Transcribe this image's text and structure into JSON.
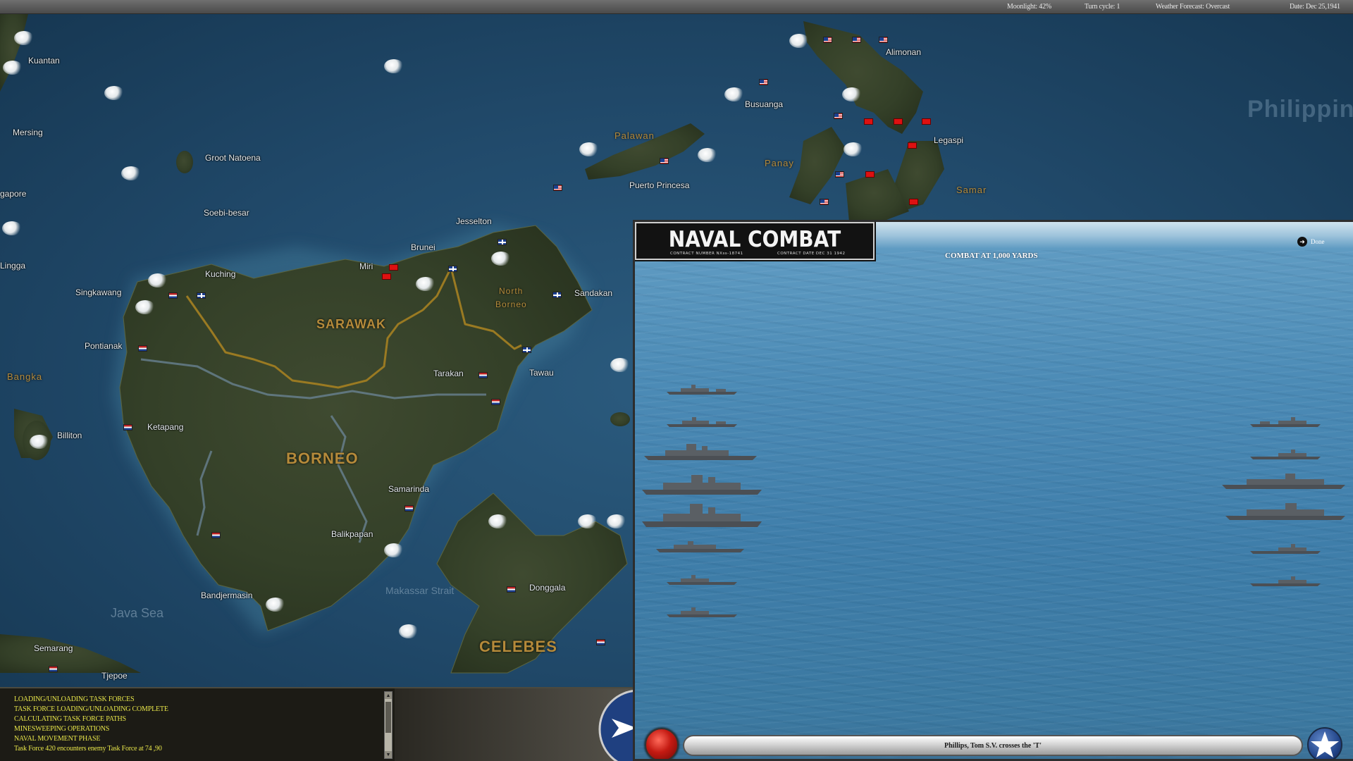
{
  "topbar": {
    "moonlight": "Moonlight: 42%",
    "turn_cycle": "Turn cycle: 1",
    "weather": "Weather Forecast: Overcast",
    "date": "Date: Dec 25,1941"
  },
  "map": {
    "places": {
      "kuantan": "Kuantan",
      "mersing": "Mersing",
      "singapore": "gapore",
      "lingga": "Lingga",
      "groot_natoena": "Groot Natoena",
      "soebi_besar": "Soebi-besar",
      "kuching": "Kuching",
      "singkawang": "Singkawang",
      "pontianak": "Pontianak",
      "billiton": "Billiton",
      "ketapang": "Ketapang",
      "brunei": "Brunei",
      "miri": "Miri",
      "jesselton": "Jesselton",
      "sandakan": "Sandakan",
      "tarakan": "Tarakan",
      "tawau": "Tawau",
      "samarinda": "Samarinda",
      "balikpapan": "Balikpapan",
      "bandjermasin": "Bandjermasin",
      "semarang": "Semarang",
      "tjepoe": "Tjepoe",
      "donggala": "Donggala",
      "busuanga": "Busuanga",
      "puerto_princesa": "Puerto Princesa",
      "alimonan": "Alimonan",
      "legaspi": "Legaspi"
    },
    "regions": {
      "sarawak": "SARAWAK",
      "borneo": "BORNEO",
      "celebes": "CELEBES",
      "north_borneo_1": "North",
      "north_borneo_2": "Borneo",
      "bangka": "Bangka",
      "palawan": "Palawan",
      "panay": "Panay",
      "samar": "Samar",
      "philippines": "Philippine"
    },
    "seas": {
      "java_sea": "Java Sea",
      "makassar": "Makassar Strait"
    }
  },
  "log": {
    "lines": [
      "LOADING/UNLOADING TASK FORCES",
      "TASK FORCE LOADING/UNLOADING COMPLETE",
      "CALCULATING TASK FORCE PATHS",
      "MINESWEEPING OPERATIONS",
      "NAVAL MOVEMENT PHASE",
      "Task Force 420 encounters enemy Task Force at 74 ,90"
    ]
  },
  "combat": {
    "title": "NAVAL COMBAT",
    "contract_number": "CONTRACT NUMBER  NXss-18741",
    "contract_date": "CONTRACT DATE  DEC  31  1942",
    "range": "COMBAT AT 1,000 YARDS",
    "done_label": "Done",
    "message": "Phillips, Tom S.V. crosses the 'T'"
  },
  "colors": {
    "log_text": "#e8e64a",
    "region_text": "#b58a3a",
    "map_water": "#214a6b"
  }
}
